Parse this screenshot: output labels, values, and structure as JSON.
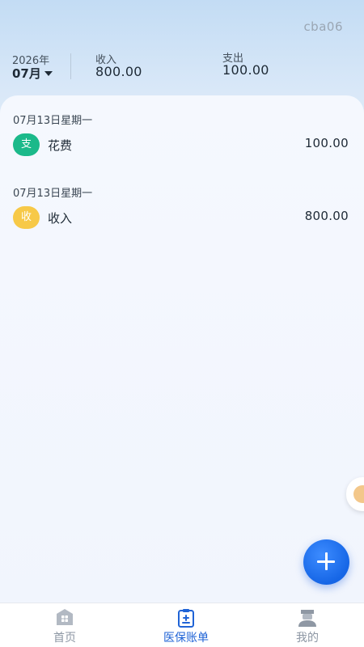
{
  "header": {
    "user_name": "cba06",
    "year": "2026年",
    "month": "07月",
    "income_label": "收入",
    "income_value": "800.00",
    "expense_label": "支出",
    "expense_value": "100.00"
  },
  "groups": [
    {
      "date": "07月13日星期一",
      "records": [
        {
          "badge": "支",
          "badge_color": "#1bb98a",
          "name": "花费",
          "amount": "100.00"
        }
      ]
    },
    {
      "date": "07月13日星期一",
      "records": [
        {
          "badge": "收",
          "badge_color": "#f7c948",
          "name": "收入",
          "amount": "800.00"
        }
      ]
    }
  ],
  "fab": {
    "icon": "plus-icon"
  },
  "tabbar": {
    "tabs": [
      {
        "label": "首页",
        "icon": "home-icon",
        "active": false
      },
      {
        "label": "医保账单",
        "icon": "clipboard-icon",
        "active": true
      },
      {
        "label": "我的",
        "icon": "user-icon",
        "active": false
      }
    ]
  },
  "colors": {
    "accent": "#1f63d6",
    "expense_badge": "#1bb98a",
    "income_badge": "#f7c948"
  }
}
